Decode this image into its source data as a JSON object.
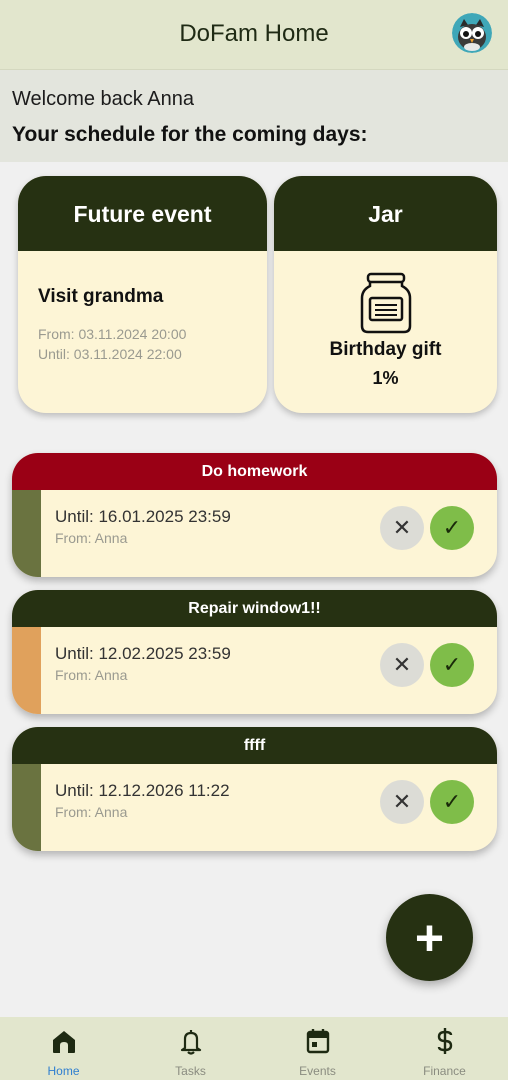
{
  "app": {
    "title": "DoFam Home"
  },
  "welcome": {
    "greeting": "Welcome back Anna",
    "schedule_heading": "Your schedule for the coming days:"
  },
  "future_event": {
    "header": "Future event",
    "title": "Visit grandma",
    "from": "From: 03.11.2024 20:00",
    "until": "Until: 03.11.2024 22:00"
  },
  "jar": {
    "header": "Jar",
    "name": "Birthday gift",
    "percent": "1%"
  },
  "tasks": [
    {
      "title": "Do homework",
      "until": "Until: 16.01.2025 23:59",
      "from": "From: Anna",
      "header_color": "#9a0015",
      "strip_color": "#6a7340"
    },
    {
      "title": "Repair window1!!",
      "until": "Until: 12.02.2025 23:59",
      "from": "From: Anna",
      "header_color": "#263112",
      "strip_color": "#e0a15c"
    },
    {
      "title": "ffff",
      "until": "Until: 12.12.2026 11:22",
      "from": "From: Anna",
      "header_color": "#263112",
      "strip_color": "#6a7340"
    }
  ],
  "task_actions": {
    "reject_icon": "✕",
    "accept_icon": "✓"
  },
  "fab": {
    "icon": "+"
  },
  "nav": [
    {
      "label": "Home",
      "icon": "home-icon",
      "active": true
    },
    {
      "label": "Tasks",
      "icon": "bell-icon",
      "active": false
    },
    {
      "label": "Events",
      "icon": "calendar-icon",
      "active": false
    },
    {
      "label": "Finance",
      "icon": "dollar-icon",
      "active": false
    }
  ],
  "colors": {
    "primary_dark": "#263112",
    "card_bg": "#fdf5d6",
    "accept_green": "#7fbd49",
    "urgent_red": "#9a0015",
    "nav_active": "#2f7fd0"
  }
}
